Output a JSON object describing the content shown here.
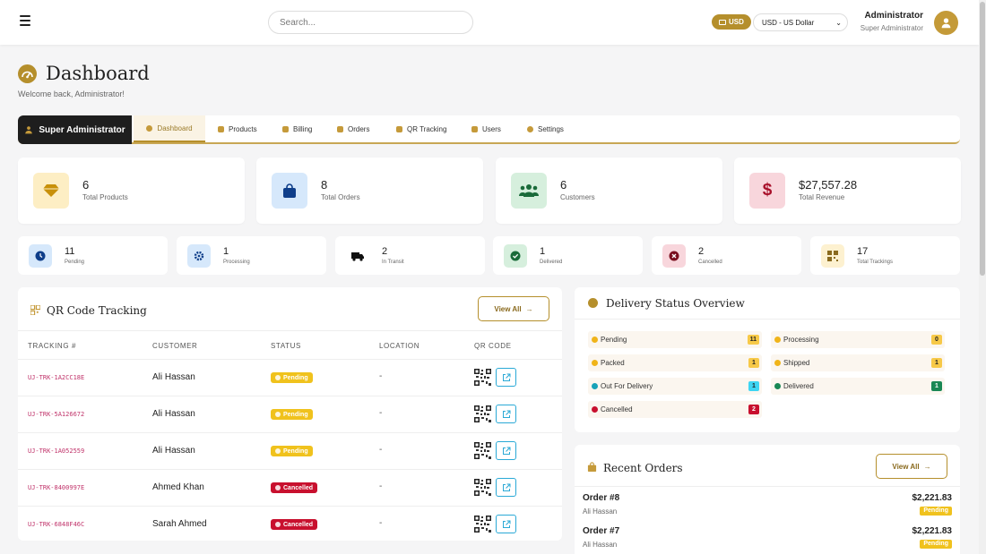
{
  "topbar": {
    "search_placeholder": "Search...",
    "currency_badge": "USD",
    "currency_select": "USD - US Dollar",
    "user_name": "Administrator",
    "user_role": "Super Administrator"
  },
  "header": {
    "title": "Dashboard",
    "welcome": "Welcome back, Administrator!"
  },
  "nav": {
    "role": "Super Administrator",
    "tabs": [
      {
        "label": "Dashboard",
        "icon": "dashboard-icon",
        "active": true
      },
      {
        "label": "Products",
        "icon": "gem-icon"
      },
      {
        "label": "Billing",
        "icon": "receipt-icon"
      },
      {
        "label": "Orders",
        "icon": "truck-icon"
      },
      {
        "label": "QR Tracking",
        "icon": "qr-icon"
      },
      {
        "label": "Users",
        "icon": "users-icon"
      },
      {
        "label": "Settings",
        "icon": "gear-icon"
      }
    ]
  },
  "stats": [
    {
      "value": "6",
      "label": "Total Products",
      "icon": "gem-icon",
      "bg": "#fdeec4"
    },
    {
      "value": "8",
      "label": "Total Orders",
      "icon": "shopping-bag-icon",
      "bg": "#d6e8fb"
    },
    {
      "value": "6",
      "label": "Customers",
      "icon": "users-icon",
      "bg": "#d6efdd"
    },
    {
      "value": "$27,557.28",
      "label": "Total Revenue",
      "icon": "dollar-icon",
      "bg": "#f8d6dc"
    }
  ],
  "mini_stats": [
    {
      "value": "11",
      "label": "Pending",
      "icon": "clock-icon",
      "bg": "#d6e8fb"
    },
    {
      "value": "1",
      "label": "Processing",
      "icon": "gear-icon",
      "bg": "#d6e8fb"
    },
    {
      "value": "2",
      "label": "In Transit",
      "icon": "truck-icon",
      "bg": "#ffffff"
    },
    {
      "value": "1",
      "label": "Delivered",
      "icon": "check-circle-icon",
      "bg": "#d6efdd"
    },
    {
      "value": "2",
      "label": "Cancelled",
      "icon": "x-circle-icon",
      "bg": "#f8d6dc"
    },
    {
      "value": "17",
      "label": "Total Trackings",
      "icon": "qr-icon",
      "bg": "#fdf1d0"
    }
  ],
  "qr_panel": {
    "title": "QR Code Tracking",
    "view_all": "View All",
    "columns": [
      "TRACKING #",
      "CUSTOMER",
      "STATUS",
      "LOCATION",
      "QR CODE"
    ],
    "rows": [
      {
        "tracking": "UJ-TRK-1A2CC18E",
        "customer": "Ali Hassan",
        "status": "Pending",
        "location": "-"
      },
      {
        "tracking": "UJ-TRK-5A126672",
        "customer": "Ali Hassan",
        "status": "Pending",
        "location": "-"
      },
      {
        "tracking": "UJ-TRK-1A052559",
        "customer": "Ali Hassan",
        "status": "Pending",
        "location": "-"
      },
      {
        "tracking": "UJ-TRK-8400997E",
        "customer": "Ahmed Khan",
        "status": "Cancelled",
        "location": "-"
      },
      {
        "tracking": "UJ-TRK-6848F46C",
        "customer": "Sarah Ahmed",
        "status": "Cancelled",
        "location": "-"
      }
    ]
  },
  "delivery": {
    "title": "Delivery Status Overview",
    "items": [
      {
        "label": "Pending",
        "count": "11",
        "dot": "#f0b41a",
        "badge": "#f7c948"
      },
      {
        "label": "Processing",
        "count": "0",
        "dot": "#f0b41a",
        "badge": "#f7c948"
      },
      {
        "label": "Packed",
        "count": "1",
        "dot": "#f0b41a",
        "badge": "#f7c948"
      },
      {
        "label": "Shipped",
        "count": "1",
        "dot": "#f0b41a",
        "badge": "#f7c948"
      },
      {
        "label": "Out For Delivery",
        "count": "1",
        "dot": "#17a2b8",
        "badge": "#3dd5f3"
      },
      {
        "label": "Delivered",
        "count": "1",
        "dot": "#198754",
        "badge": "#198754"
      },
      {
        "label": "Cancelled",
        "count": "2",
        "dot": "#c8102e",
        "badge": "#c8102e"
      }
    ]
  },
  "recent_orders": {
    "title": "Recent Orders",
    "view_all": "View All",
    "orders": [
      {
        "number": "Order #8",
        "customer": "Ali Hassan",
        "amount": "$2,221.83",
        "status": "Pending"
      },
      {
        "number": "Order #7",
        "customer": "Ali Hassan",
        "amount": "$2,221.83",
        "status": "Pending"
      }
    ]
  },
  "colors": {
    "accent": "#b58f2c",
    "pending": "#f0c21d",
    "cancelled": "#c8102e"
  }
}
